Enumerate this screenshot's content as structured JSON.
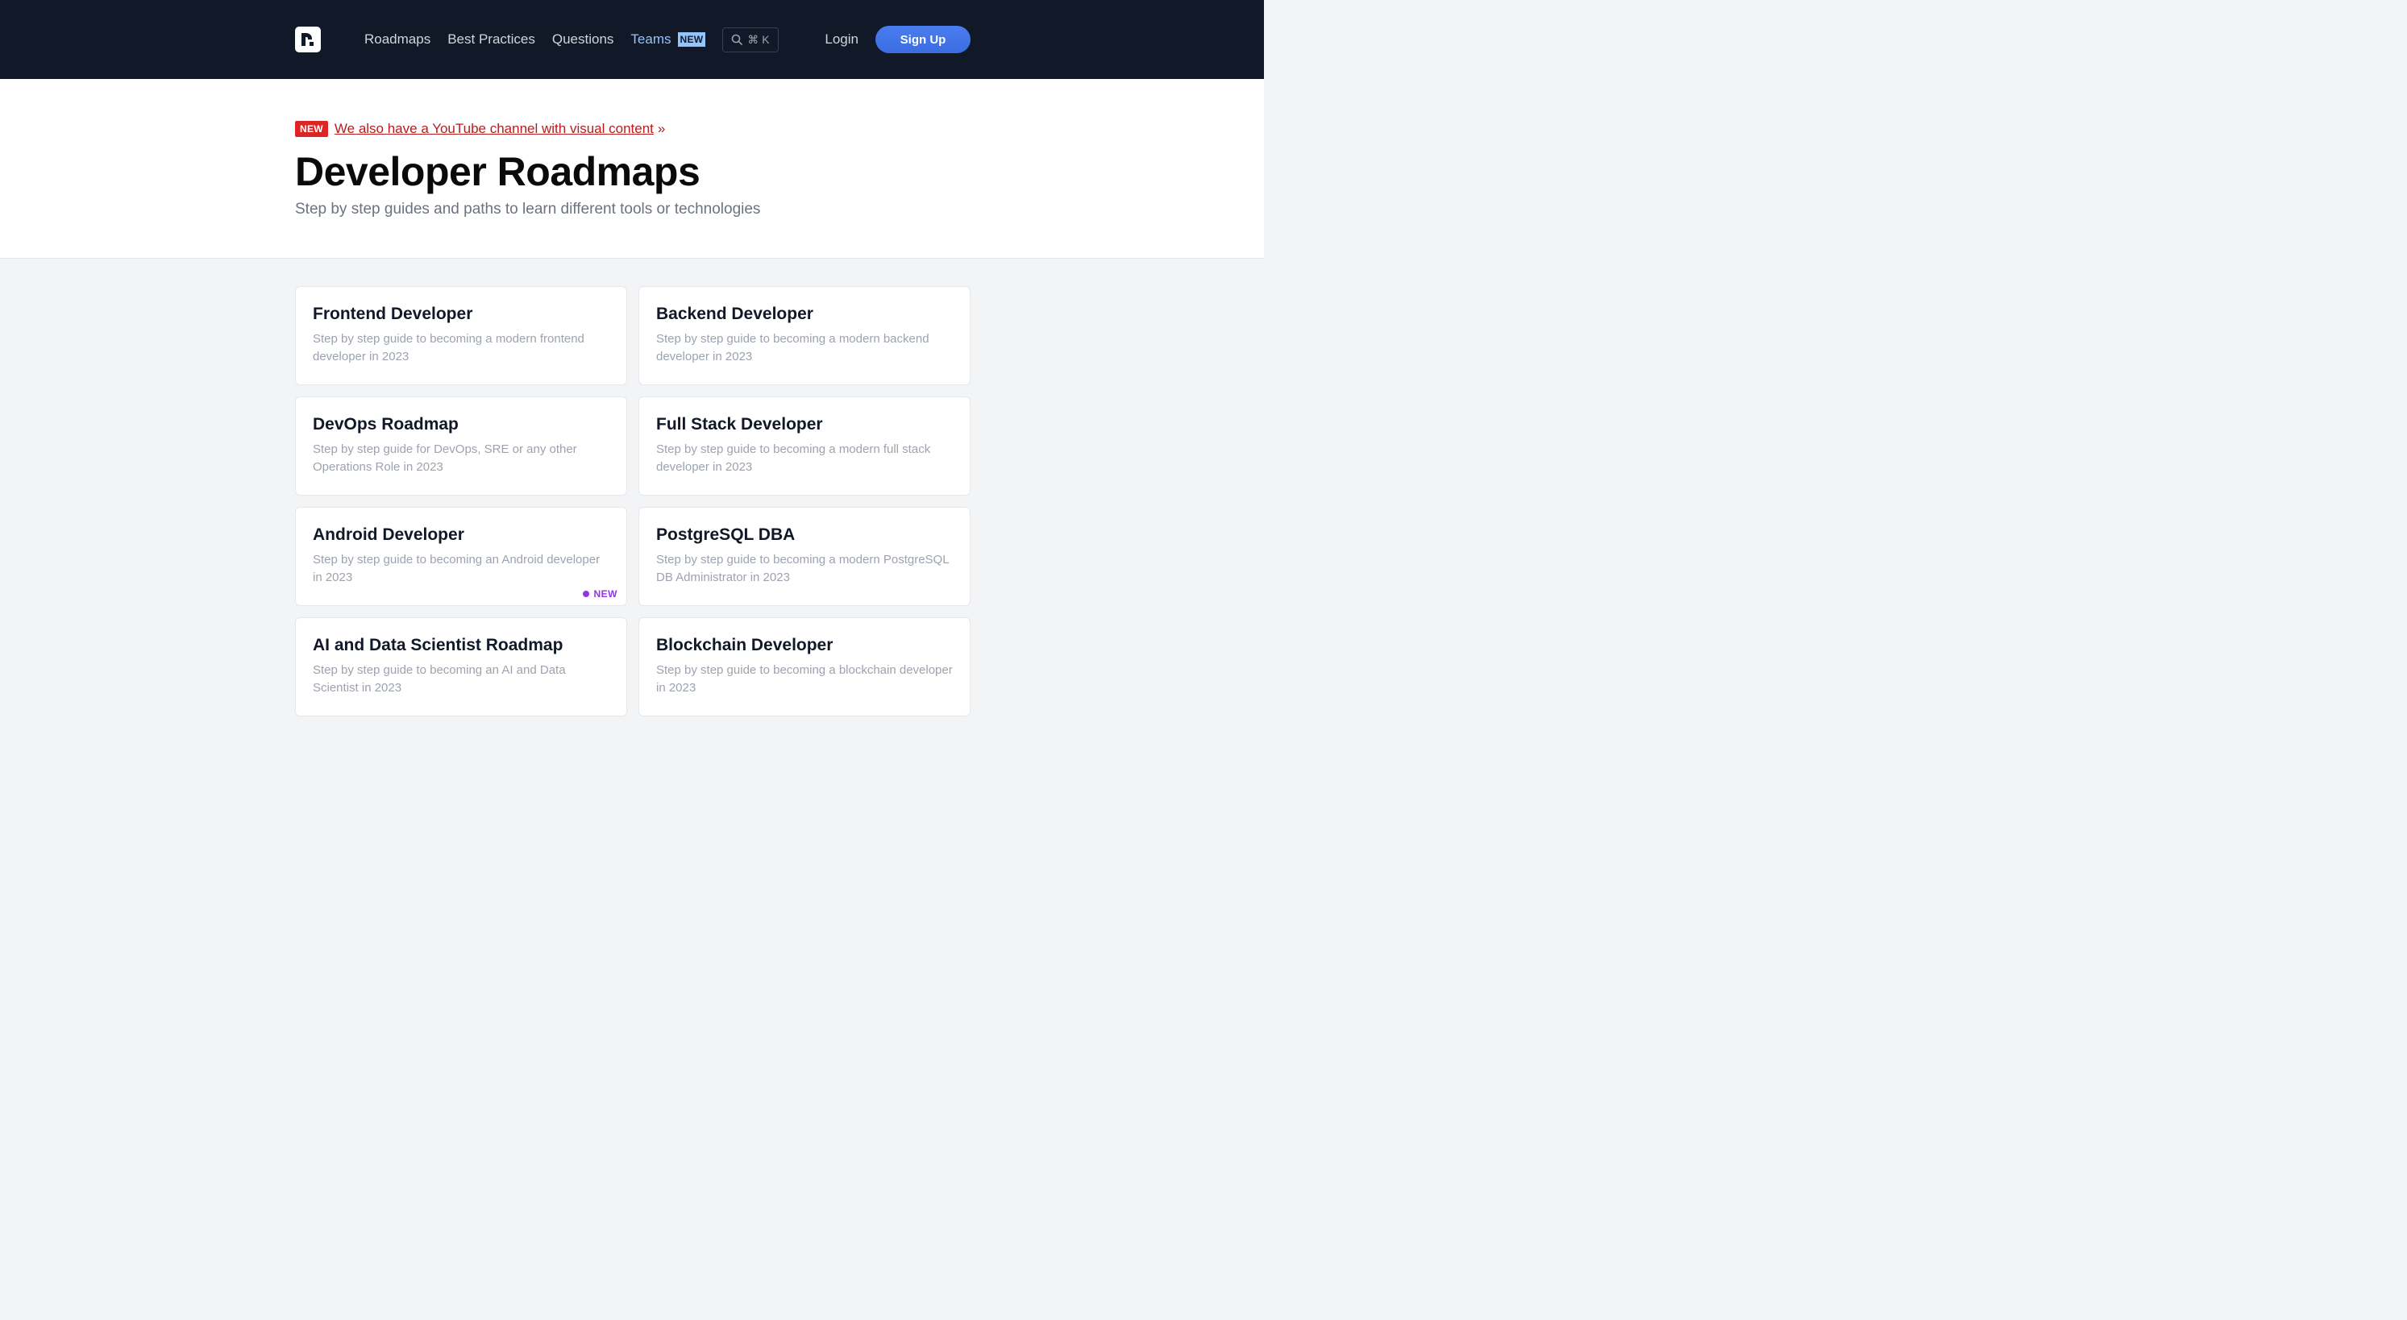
{
  "nav": {
    "links": [
      "Roadmaps",
      "Best Practices",
      "Questions"
    ],
    "teams_label": "Teams",
    "teams_badge": "NEW",
    "search_shortcut": "⌘ K",
    "login": "Login",
    "signup": "Sign Up"
  },
  "hero": {
    "badge": "NEW",
    "announcement": "We also have a YouTube channel with visual content",
    "announcement_arrow": "»",
    "title": "Developer Roadmaps",
    "subtitle": "Step by step guides and paths to learn different tools or technologies"
  },
  "cards": [
    {
      "title": "Frontend Developer",
      "desc": "Step by step guide to becoming a modern frontend developer in 2023"
    },
    {
      "title": "Backend Developer",
      "desc": "Step by step guide to becoming a modern backend developer in 2023"
    },
    {
      "title": "DevOps Roadmap",
      "desc": "Step by step guide for DevOps, SRE or any other Operations Role in 2023"
    },
    {
      "title": "Full Stack Developer",
      "desc": "Step by step guide to becoming a modern full stack developer in 2023"
    },
    {
      "title": "Android Developer",
      "desc": "Step by step guide to becoming an Android developer in 2023",
      "badge": "NEW"
    },
    {
      "title": "PostgreSQL DBA",
      "desc": "Step by step guide to becoming a modern PostgreSQL DB Administrator in 2023"
    },
    {
      "title": "AI and Data Scientist Roadmap",
      "desc": "Step by step guide to becoming an AI and Data Scientist in 2023"
    },
    {
      "title": "Blockchain Developer",
      "desc": "Step by step guide to becoming a blockchain developer in 2023"
    }
  ],
  "colors": {
    "nav_bg": "#111827",
    "accent_blue": "#3b6de0",
    "announce_red": "#dc2626",
    "new_purple": "#9333ea"
  }
}
